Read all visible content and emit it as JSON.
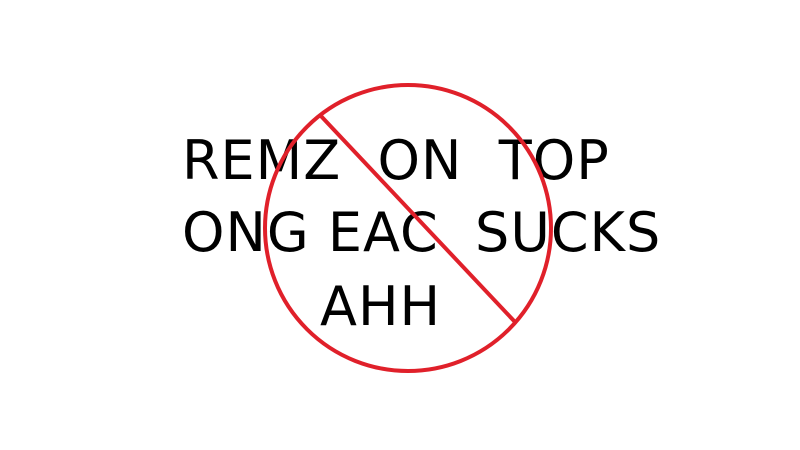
{
  "text": {
    "line1": "REMZ  ON  TOP",
    "line2": "ONG EAC  SUCKS",
    "line3": "AHH"
  },
  "colors": {
    "background": "#ffffff",
    "text": "#000000",
    "prohibition_sign": "#e0202a"
  },
  "icons": {
    "overlay": "prohibition-sign-icon"
  }
}
